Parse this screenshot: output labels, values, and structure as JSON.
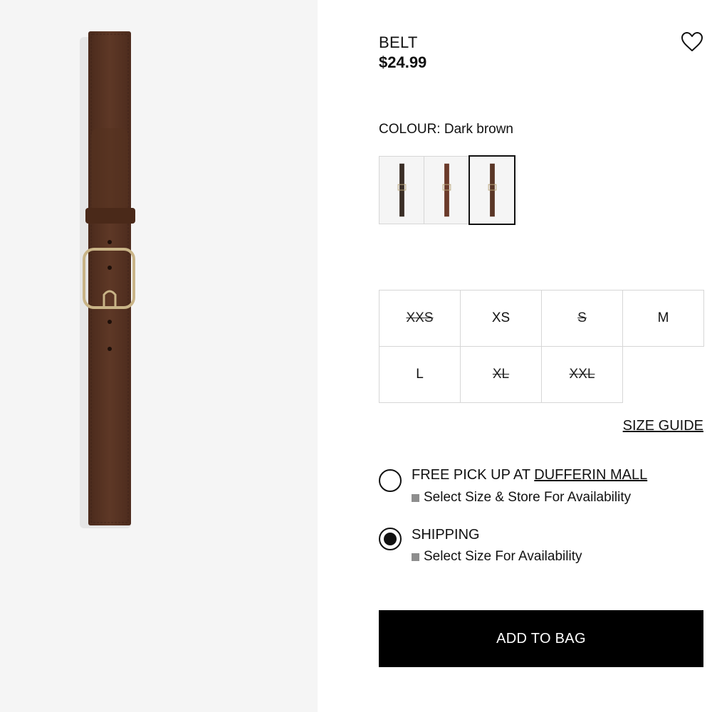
{
  "product": {
    "title": "BELT",
    "price": "$24.99",
    "image": "product-image-dark-brown-suede-belt"
  },
  "wishlist": {
    "icon": "heart-outline-icon"
  },
  "colour": {
    "label_prefix": "COLOUR:",
    "selected": "Dark brown",
    "swatches": [
      {
        "name": "black",
        "color": "#3a2e26",
        "selected": false
      },
      {
        "name": "brown",
        "color": "#6b3a2a",
        "selected": false
      },
      {
        "name": "dark-brown",
        "color": "#5a3626",
        "selected": true
      }
    ]
  },
  "sizes": [
    {
      "label": "XXS",
      "available": false
    },
    {
      "label": "XS",
      "available": true
    },
    {
      "label": "S",
      "available": false
    },
    {
      "label": "M",
      "available": true
    },
    {
      "label": "L",
      "available": true
    },
    {
      "label": "XL",
      "available": false
    },
    {
      "label": "XXL",
      "available": false
    }
  ],
  "size_guide": "SIZE GUIDE",
  "delivery": {
    "pickup": {
      "title": "FREE PICK UP AT",
      "store": "DUFFERIN MALL",
      "note": "Select Size & Store For Availability",
      "selected": false
    },
    "shipping": {
      "title": "SHIPPING",
      "note": "Select Size For Availability",
      "selected": true
    }
  },
  "add_to_bag": "ADD TO BAG",
  "colors": {
    "belt": "#5a3524",
    "buckle": "#c9b487",
    "button_bg": "#000000",
    "panel_bg": "#f5f5f5"
  }
}
